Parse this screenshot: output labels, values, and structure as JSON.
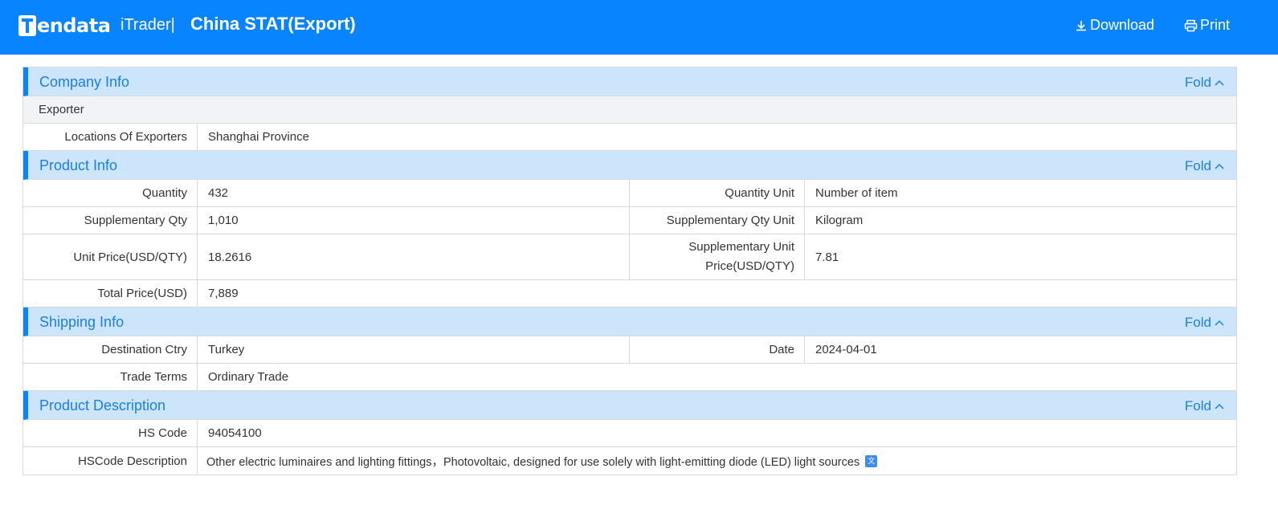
{
  "header": {
    "logo_text": "endata",
    "product": "iTrader|",
    "title": "China STAT(Export)",
    "download_label": "Download",
    "print_label": "Print"
  },
  "fold_label": "Fold",
  "sections": {
    "company": {
      "title": "Company Info",
      "subhead": "Exporter",
      "rows": [
        {
          "label": "Locations Of Exporters",
          "value": "Shanghai Province"
        }
      ]
    },
    "product": {
      "title": "Product Info",
      "quantity_label": "Quantity",
      "quantity": "432",
      "quantity_unit_label": "Quantity Unit",
      "quantity_unit": "Number of item",
      "supp_qty_label": "Supplementary Qty",
      "supp_qty": "1,010",
      "supp_qty_unit_label": "Supplementary Qty Unit",
      "supp_qty_unit": "Kilogram",
      "unit_price_label": "Unit Price(USD/QTY)",
      "unit_price": "18.2616",
      "supp_unit_price_label_1": "Supplementary Unit",
      "supp_unit_price_label_2": "Price(USD/QTY)",
      "supp_unit_price": "7.81",
      "total_price_label": "Total Price(USD)",
      "total_price": "7,889"
    },
    "shipping": {
      "title": "Shipping Info",
      "dest_label": "Destination Ctry",
      "dest": "Turkey",
      "date_label": "Date",
      "date": "2024-04-01",
      "terms_label": "Trade Terms",
      "terms": "Ordinary Trade"
    },
    "description": {
      "title": "Product Description",
      "hs_label": "HS Code",
      "hs": "94054100",
      "hs_desc_label": "HSCode Description",
      "hs_desc": "Other electric luminaires and lighting fittings，Photovoltaic, designed for use solely with light-emitting diode (LED) light sources"
    }
  },
  "icons": {
    "download": "download-icon",
    "print": "printer-icon",
    "fold": "chevron-up-icon",
    "translate": "translate-icon"
  },
  "colors": {
    "header_bg": "#0984ff",
    "section_bg": "#cce5fb",
    "accent_text": "#1a7fe0"
  }
}
